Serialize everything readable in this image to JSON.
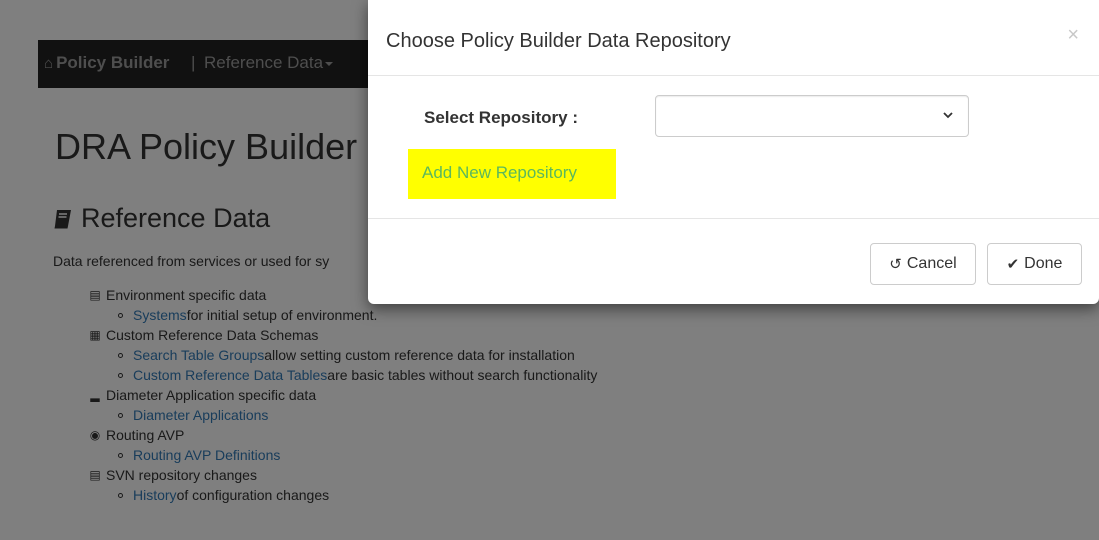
{
  "navbar": {
    "brand": "Policy Builder",
    "brand_icon": "home-icon",
    "separator": "|",
    "menu_label": "Reference Data"
  },
  "page": {
    "title": "DRA Policy Builder",
    "section_title": "Reference Data",
    "section_icon": "book-icon",
    "description": "Data referenced from services or used for sy",
    "tree": [
      {
        "label": "Environment specific data",
        "icon": "hdd-icon",
        "children": [
          {
            "link": "Systems",
            "text": " for initial setup of environment."
          }
        ]
      },
      {
        "label": "Custom Reference Data Schemas",
        "icon": "table-icon",
        "children": [
          {
            "link": "Search Table Groups",
            "text": " allow setting custom reference data for installation"
          },
          {
            "link": "Custom Reference Data Tables",
            "text": " are basic tables without search functionality"
          }
        ]
      },
      {
        "label": "Diameter Application specific data",
        "icon": "signal-bars-icon",
        "children": [
          {
            "link": "Diameter Applications",
            "text": ""
          }
        ]
      },
      {
        "label": "Routing AVP",
        "icon": "wifi-icon",
        "children": [
          {
            "link": "Routing AVP Definitions",
            "text": ""
          }
        ]
      },
      {
        "label": "SVN repository changes",
        "icon": "document-icon",
        "children": [
          {
            "link": "History",
            "text": " of configuration changes"
          }
        ]
      }
    ]
  },
  "modal": {
    "title": "Choose Policy Builder Data Repository",
    "close_label": "×",
    "select_label": "Select Repository :",
    "select_value": "",
    "add_link": "Add New Repository",
    "cancel_label": "Cancel",
    "done_label": "Done",
    "highlight_color": "#ffff00",
    "add_link_color": "#5cb85c"
  }
}
